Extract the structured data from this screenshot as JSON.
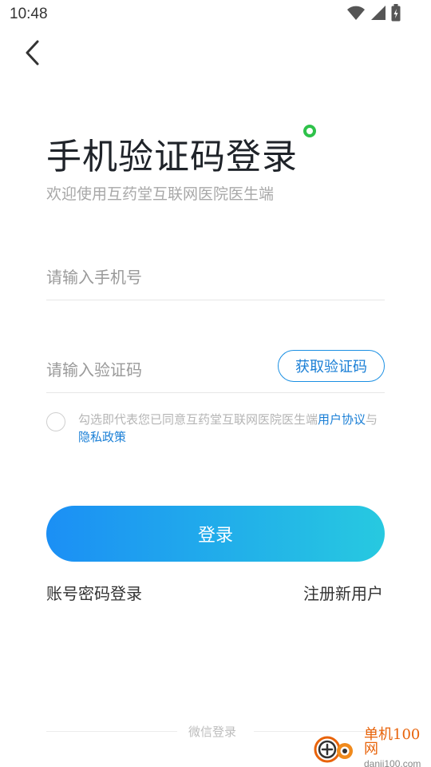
{
  "status_bar": {
    "time": "10:48",
    "icons": [
      "wifi-icon",
      "signal-icon",
      "battery-charging-icon"
    ]
  },
  "header": {
    "back_icon": "chevron-left-icon"
  },
  "main": {
    "title": "手机验证码登录",
    "subtitle": "欢迎使用互药堂互联网医院医生端",
    "phone_placeholder": "请输入手机号",
    "code_placeholder": "请输入验证码",
    "get_code_label": "获取验证码",
    "agreement": {
      "prefix": "勾选即代表您已同意互药堂互联网医院医生端",
      "user_agreement": "用户协议",
      "joiner": "与",
      "privacy_policy": "隐私政策"
    },
    "login_label": "登录",
    "password_login": "账号密码登录",
    "register": "注册新用户",
    "wechat_login": "微信登录"
  },
  "watermark": {
    "name": "单机100网",
    "domain": "danji100.com"
  },
  "colors": {
    "accent": "#1a7fd6",
    "gradient_start": "#1b8ff5",
    "gradient_end": "#27c9e0",
    "title_dot": "#2ec24a",
    "watermark": "#e8630a"
  }
}
